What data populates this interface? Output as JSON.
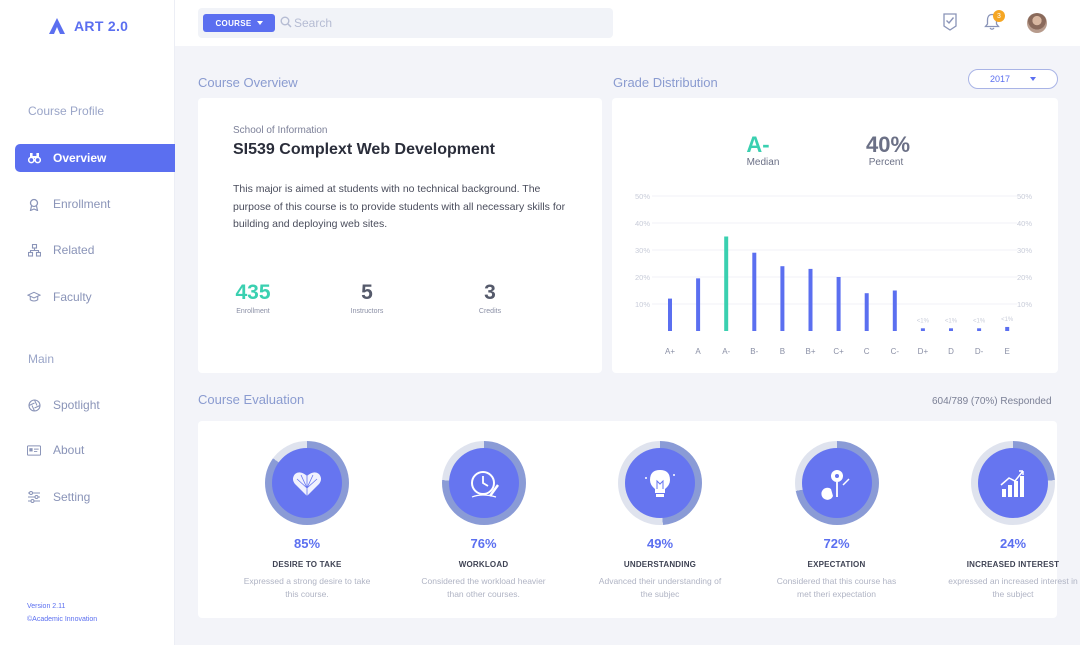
{
  "app": {
    "name": "ART 2.0",
    "version": "Version 2.11",
    "org": "©Academic Innovation"
  },
  "sidebar": {
    "section1": "Course Profile",
    "items1": [
      {
        "label": "Overview",
        "icon": "binoculars-icon",
        "active": true
      },
      {
        "label": "Enrollment",
        "icon": "award-icon"
      },
      {
        "label": "Related",
        "icon": "sitemap-icon"
      },
      {
        "label": "Faculty",
        "icon": "graduation-cap-icon"
      }
    ],
    "section2": "Main",
    "items2": [
      {
        "label": "Spotlight",
        "icon": "aperture-icon"
      },
      {
        "label": "About",
        "icon": "id-card-icon"
      },
      {
        "label": "Setting",
        "icon": "sliders-icon"
      }
    ]
  },
  "topbar": {
    "filter_label": "COURSE",
    "search_placeholder": "Search",
    "notification_count": "3"
  },
  "overview": {
    "title": "Course Overview",
    "school": "School of Information",
    "course": "SI539 Complext Web Development",
    "description": "This major is aimed at students with no technical background. The purpose of this course is to provide students with all necessary skills for building and deploying web sites.",
    "stats": [
      {
        "value": "435",
        "label": "Enrollment",
        "color": "#3ad0b0"
      },
      {
        "value": "5",
        "label": "Instructors",
        "color": "#555a6b"
      },
      {
        "value": "3",
        "label": "Credits",
        "color": "#555a6b"
      }
    ]
  },
  "grade": {
    "title": "Grade Distribution",
    "year": "2017",
    "median_value": "A-",
    "median_label": "Median",
    "percent_value": "40%",
    "percent_label": "Percent"
  },
  "chart_data": {
    "type": "bar",
    "categories": [
      "A+",
      "A",
      "A-",
      "B-",
      "B",
      "B+",
      "C+",
      "C",
      "C-",
      "D+",
      "D",
      "D-",
      "E"
    ],
    "values": [
      12,
      19.5,
      35,
      29,
      24,
      23,
      20,
      14,
      15,
      1,
      1,
      1,
      1.5
    ],
    "data_labels": [
      "",
      "",
      "",
      "",
      "",
      "",
      "",
      "",
      "",
      "<1%",
      "<1%",
      "<1%",
      "<1%"
    ],
    "highlight": "A-",
    "ylim": [
      0,
      50
    ],
    "yticks": [
      "10%",
      "20%",
      "30%",
      "40%",
      "50%"
    ],
    "colors": {
      "bar": "#5b6ff0",
      "highlight": "#3ad0b0"
    }
  },
  "evaluation": {
    "title": "Course Evaluation",
    "responded": "604/789  (70%) Responded",
    "items": [
      {
        "pct": "85%",
        "value": 0.85,
        "title": "DESIRE TO TAKE",
        "desc": "Expressed a strong desire to take this course.",
        "icon": "heart-icon"
      },
      {
        "pct": "76%",
        "value": 0.76,
        "title": "WORKLOAD",
        "desc": "Considered the workload heavier than other courses.",
        "icon": "clock-icon"
      },
      {
        "pct": "49%",
        "value": 0.49,
        "title": "UNDERSTANDING",
        "desc": "Advanced their understanding of the subjec",
        "icon": "lightbulb-icon"
      },
      {
        "pct": "72%",
        "value": 0.72,
        "title": "EXPECTATION",
        "desc": "Considered that this course has met theri expectation",
        "icon": "compass-icon"
      },
      {
        "pct": "24%",
        "value": 0.24,
        "title": "INCREASED INTEREST",
        "desc": "expressed an increased interest in the subject",
        "icon": "growth-chart-icon"
      }
    ]
  }
}
